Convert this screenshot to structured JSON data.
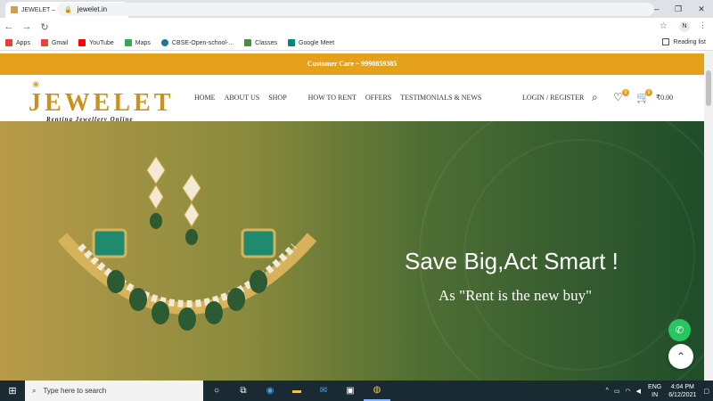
{
  "browser": {
    "tab_title": "JEWELET – Renting Jewellery Onli",
    "url": "jewelet.in",
    "profile_initial": "N",
    "bookmarks": [
      {
        "label": "Apps",
        "color": "#e34133"
      },
      {
        "label": "Gmail",
        "color": "#ea4335"
      },
      {
        "label": "YouTube",
        "color": "#ff0000"
      },
      {
        "label": "Maps",
        "color": "#34a853"
      },
      {
        "label": "CBSE-Open-school-...",
        "color": "#21759b"
      },
      {
        "label": "Classes",
        "color": "#4a8f3f"
      },
      {
        "label": "Google Meet",
        "color": "#00897b"
      }
    ],
    "reading_list": "Reading list"
  },
  "site": {
    "topbar": "Customer Care ~ 9990859385",
    "logo_name": "JEWELET",
    "logo_tagline": "Renting Jewellery Online",
    "menu": [
      "HOME",
      "ABOUT US",
      "SHOP",
      "HOW TO RENT",
      "OFFERS",
      "TESTIMONIALS & NEWS"
    ],
    "login": "LOGIN / REGISTER",
    "wishlist_count": "0",
    "cart_count": "0",
    "cart_total": "₹0.00",
    "hero_headline": "Save Big,Act Smart !",
    "hero_sub": "As \"Rent is the new buy\""
  },
  "taskbar": {
    "search_placeholder": "Type here to search",
    "lang": "ENG",
    "region": "IN",
    "time": "4:04 PM",
    "date": "6/12/2021"
  }
}
